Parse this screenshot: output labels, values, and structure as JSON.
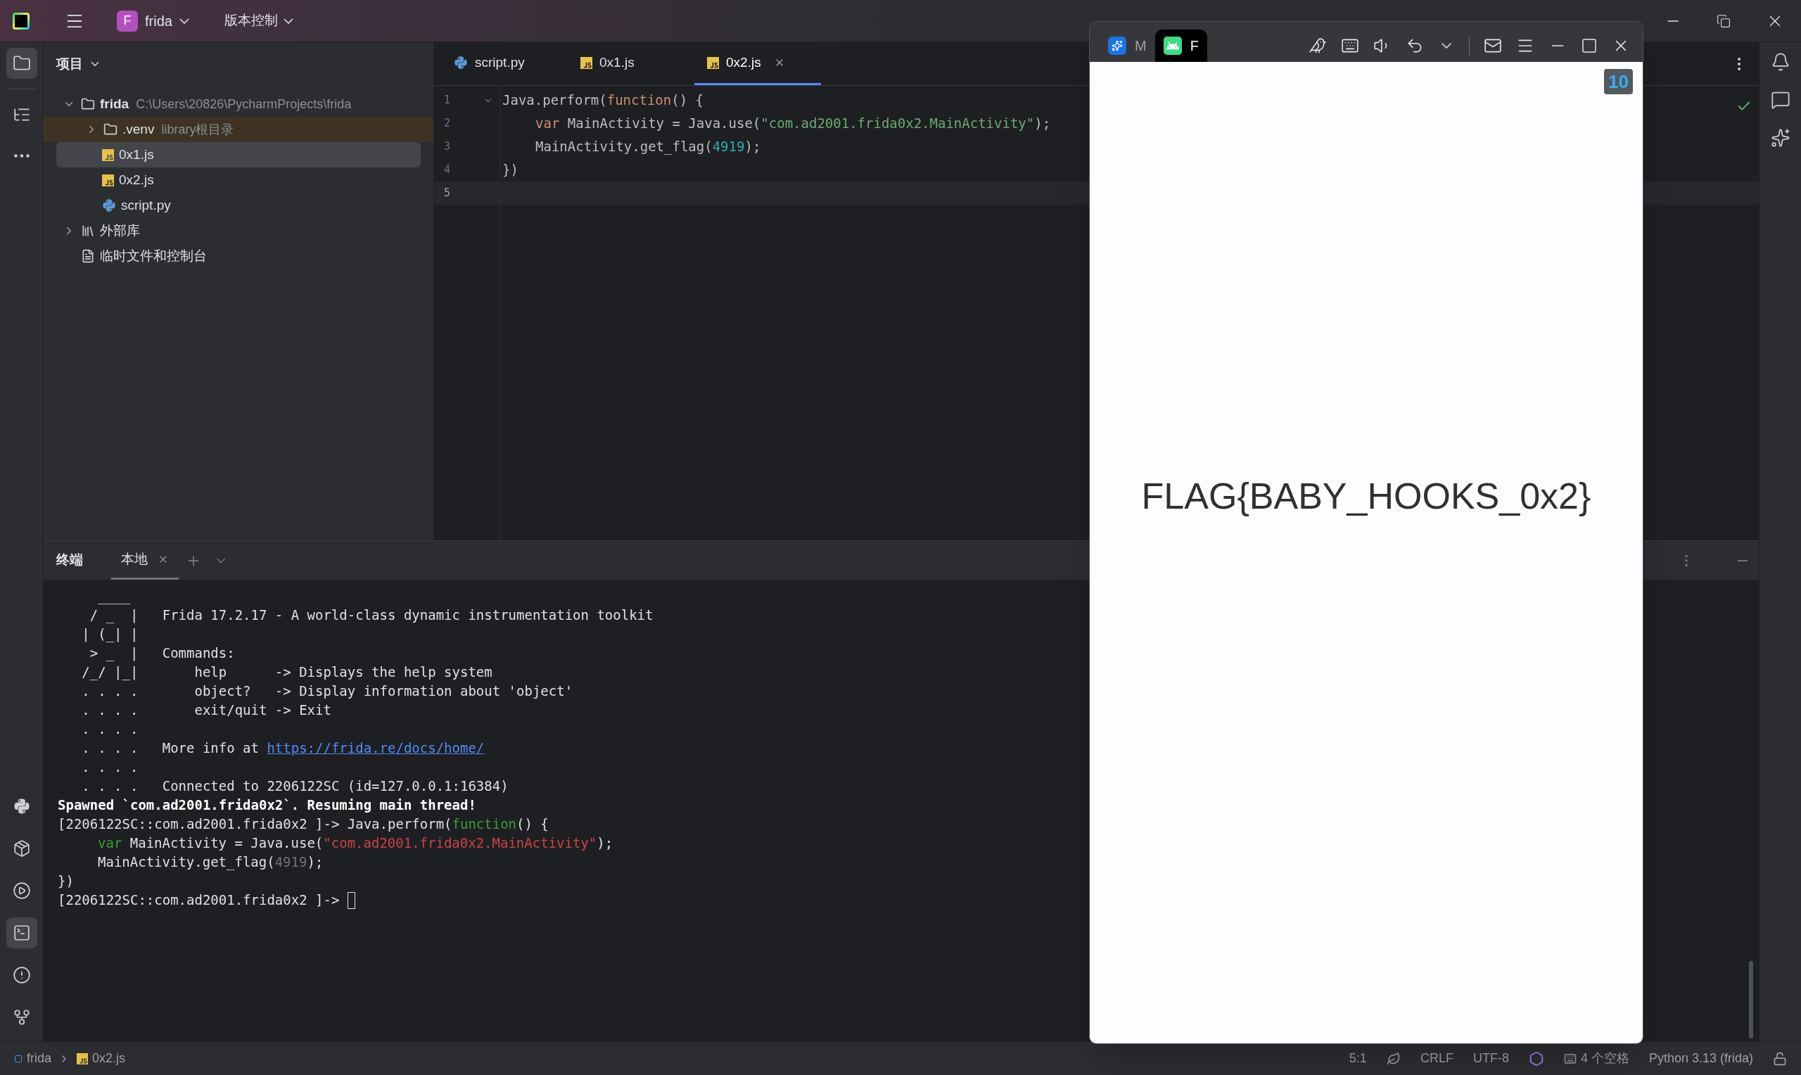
{
  "title_bar": {
    "project_badge": "F",
    "project": "frida",
    "vcs": "版本控制"
  },
  "left_toolbar": {
    "top": [
      {
        "kind": "folder",
        "selected": true
      },
      {
        "kind": "structure",
        "selected": false
      },
      {
        "kind": "more",
        "selected": false
      }
    ],
    "bottom": [
      {
        "kind": "python",
        "selected": false
      },
      {
        "kind": "packages",
        "selected": false
      },
      {
        "kind": "services",
        "selected": false
      },
      {
        "kind": "terminal",
        "selected": true
      },
      {
        "kind": "problems",
        "selected": false
      },
      {
        "kind": "git",
        "selected": false
      }
    ]
  },
  "project_panel": {
    "title": "项目",
    "tree": [
      {
        "name": "frida",
        "kind": "folder",
        "hint": "C:\\Users\\20826\\PycharmProjects\\frida",
        "expanded": true,
        "selected": false,
        "highlighted": false,
        "children": [
          {
            "name": ".venv",
            "kind": "folder",
            "hint": "library根目录",
            "expanded": false,
            "selected": false,
            "highlighted": true
          },
          {
            "name": "0x1.js",
            "kind": "js",
            "selected": true,
            "highlighted": false
          },
          {
            "name": "0x2.js",
            "kind": "js",
            "selected": false,
            "highlighted": false
          },
          {
            "name": "script.py",
            "kind": "python",
            "selected": false,
            "highlighted": false
          }
        ]
      },
      {
        "name": "外部库",
        "kind": "library",
        "expanded": false,
        "selected": false,
        "highlighted": false
      },
      {
        "name": "临时文件和控制台",
        "kind": "scratch",
        "selected": false,
        "highlighted": false
      }
    ]
  },
  "editor": {
    "tabs": [
      {
        "label": "script.py",
        "kind": "python",
        "selected": false
      },
      {
        "label": "0x1.js",
        "kind": "js",
        "selected": false
      },
      {
        "label": "0x2.js",
        "kind": "js",
        "selected": true
      }
    ],
    "lines": [
      {
        "number": "1",
        "current": false,
        "indented": false,
        "tokens": [
          {
            "text": "Java.perform(",
            "kind": "plain"
          },
          {
            "text": "function",
            "kind": "keyword"
          },
          {
            "text": "() {",
            "kind": "plain"
          }
        ]
      },
      {
        "number": "2",
        "current": false,
        "indented": true,
        "tokens": [
          {
            "text": "var",
            "kind": "keyword"
          },
          {
            "text": " MainActivity = Java.use(",
            "kind": "plain"
          },
          {
            "text": "\"com.ad2001.frida0x2.MainActivity\"",
            "kind": "string"
          },
          {
            "text": ");",
            "kind": "plain"
          }
        ]
      },
      {
        "number": "3",
        "current": false,
        "indented": true,
        "tokens": [
          {
            "text": "MainActivity.get_flag(",
            "kind": "plain"
          },
          {
            "text": "4919",
            "kind": "number"
          },
          {
            "text": ");",
            "kind": "plain"
          }
        ]
      },
      {
        "number": "4",
        "current": false,
        "indented": false,
        "tokens": [
          {
            "text": "})",
            "kind": "plain"
          }
        ]
      },
      {
        "number": "5",
        "current": true,
        "indented": false
      }
    ]
  },
  "terminal": {
    "title": "终端",
    "tabs": [
      {
        "label": "本地",
        "selected": true
      }
    ],
    "lines": [
      {
        "tokens": [
          {
            "text": "     ____",
            "kind": "plain"
          }
        ]
      },
      {
        "tokens": [
          {
            "text": "    / _  |   Frida 17.2.17 - A world-class dynamic instrumentation toolkit",
            "kind": "plain"
          }
        ]
      },
      {
        "tokens": [
          {
            "text": "   | (_| |",
            "kind": "plain"
          }
        ]
      },
      {
        "tokens": [
          {
            "text": "    > _  |   Commands:",
            "kind": "plain"
          }
        ]
      },
      {
        "tokens": [
          {
            "text": "   /_/ |_|       help      -> Displays the help system",
            "kind": "plain"
          }
        ]
      },
      {
        "tokens": [
          {
            "text": "   . . . .       object?   -> Display information about 'object'",
            "kind": "plain"
          }
        ]
      },
      {
        "tokens": [
          {
            "text": "   . . . .       exit/quit -> Exit",
            "kind": "plain"
          }
        ]
      },
      {
        "tokens": [
          {
            "text": "   . . . .",
            "kind": "plain"
          }
        ]
      },
      {
        "tokens": [
          {
            "text": "   . . . .   More info at ",
            "kind": "plain"
          },
          {
            "text": "https://frida.re/docs/home/",
            "kind": "link"
          }
        ]
      },
      {
        "tokens": [
          {
            "text": "   . . . .",
            "kind": "plain"
          }
        ]
      },
      {
        "tokens": [
          {
            "text": "   . . . .   Connected to 2206122SC (id=127.0.0.1:16384)",
            "kind": "plain"
          }
        ]
      },
      {
        "tokens": [
          {
            "text": "Spawned `com.ad2001.frida0x2`. Resuming main thread!",
            "kind": "bold"
          }
        ]
      },
      {
        "tokens": [
          {
            "text": "[2206122SC::com.ad2001.frida0x2 ]-> Java.perform(",
            "kind": "plain"
          },
          {
            "text": "function",
            "kind": "keyword"
          },
          {
            "text": "() {",
            "kind": "plain"
          }
        ]
      },
      {
        "indented": true,
        "tokens": [
          {
            "text": "var",
            "kind": "keyword"
          },
          {
            "text": " MainActivity = Java.use(",
            "kind": "plain"
          },
          {
            "text": "\"com.ad2001.frida0x2.MainActivity\"",
            "kind": "string"
          },
          {
            "text": ");",
            "kind": "plain"
          }
        ]
      },
      {
        "indented": true,
        "tokens": [
          {
            "text": "MainActivity.get_flag(",
            "kind": "plain"
          },
          {
            "text": "4919",
            "kind": "number"
          },
          {
            "text": ");",
            "kind": "plain"
          }
        ]
      },
      {
        "tokens": [
          {
            "text": "})",
            "kind": "plain"
          }
        ]
      },
      {
        "cursor": true,
        "tokens": [
          {
            "text": "[2206122SC::com.ad2001.frida0x2 ]-> ",
            "kind": "plain"
          }
        ]
      }
    ]
  },
  "emulator": {
    "tabs": [
      {
        "label": "M",
        "kind": "app",
        "selected": false
      },
      {
        "label": "F",
        "kind": "android",
        "selected": true
      }
    ],
    "badge": "10",
    "message": "FLAG{BABY_HOOKS_0x2}"
  },
  "status_bar": {
    "breadcrumbs": [
      {
        "label": "frida",
        "kind": "module"
      },
      {
        "label": "0x2.js",
        "kind": "js"
      }
    ],
    "position": "5:1",
    "line_separator": "CRLF",
    "encoding": "UTF-8",
    "indent": "4 个空格",
    "interpreter": "Python 3.13 (frida)"
  }
}
